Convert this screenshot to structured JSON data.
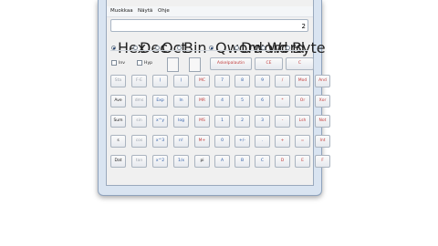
{
  "menu": [
    "Muokkaa",
    "Näytä",
    "Ohje"
  ],
  "display": {
    "value": "2"
  },
  "base_radios": [
    {
      "label": "Hex",
      "checked": true
    },
    {
      "label": "Dec",
      "checked": false
    },
    {
      "label": "Oct",
      "checked": false
    },
    {
      "label": "Bin",
      "checked": false
    }
  ],
  "word_radios": [
    {
      "label": "Qword",
      "checked": true
    },
    {
      "label": "Dword",
      "checked": false
    },
    {
      "label": "Word",
      "checked": false
    },
    {
      "label": "Byte",
      "checked": false
    }
  ],
  "checks": [
    "Inv",
    "Hyp"
  ],
  "top_buttons": [
    "Askelpalautin",
    "CE",
    "C"
  ],
  "keypad": [
    [
      "Sta",
      "F-E",
      "(",
      ")",
      "MC",
      "7",
      "8",
      "9",
      "/",
      "Mod",
      "And"
    ],
    [
      "Ave",
      "dms",
      "Exp",
      "ln",
      "MR",
      "4",
      "5",
      "6",
      "*",
      "Or",
      "Xor"
    ],
    [
      "Sum",
      "sin",
      "x^y",
      "log",
      "MS",
      "1",
      "2",
      "3",
      "-",
      "Lsh",
      "Not"
    ],
    [
      "s",
      "cos",
      "x^3",
      "n!",
      "M+",
      "0",
      "+/-",
      ".",
      "+",
      "=",
      "Int"
    ],
    [
      "Dat",
      "tan",
      "x^2",
      "1/x",
      "pi",
      "A",
      "B",
      "C",
      "D",
      "E",
      "F"
    ]
  ]
}
